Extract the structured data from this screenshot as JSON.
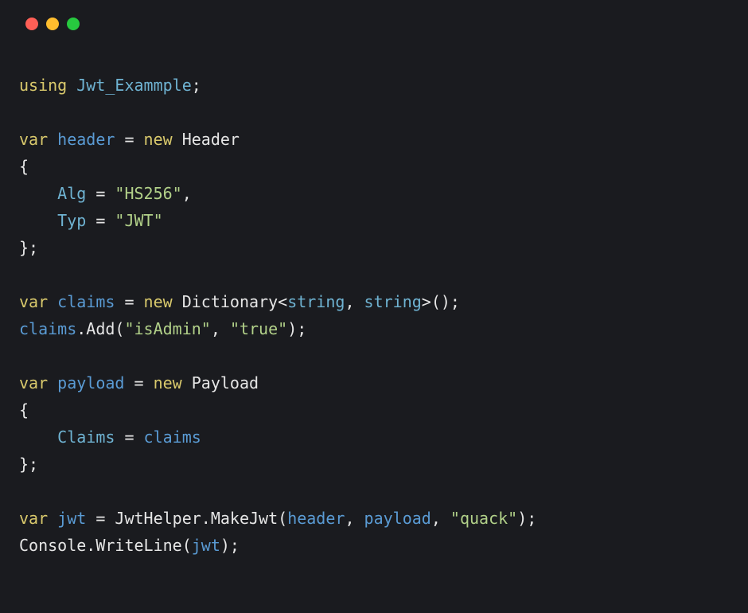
{
  "titlebar": {
    "dots": [
      "red",
      "yellow",
      "green"
    ]
  },
  "code": {
    "lines": [
      {
        "tokens": [
          {
            "t": "using",
            "c": "tok-keyword"
          },
          {
            "t": " ",
            "c": "tok-punct"
          },
          {
            "t": "Jwt_Exammple",
            "c": "tok-type"
          },
          {
            "t": ";",
            "c": "tok-punct"
          }
        ]
      },
      {
        "tokens": []
      },
      {
        "tokens": [
          {
            "t": "var",
            "c": "tok-keyword"
          },
          {
            "t": " ",
            "c": "tok-punct"
          },
          {
            "t": "header",
            "c": "tok-var"
          },
          {
            "t": " = ",
            "c": "tok-punct"
          },
          {
            "t": "new",
            "c": "tok-new"
          },
          {
            "t": " ",
            "c": "tok-punct"
          },
          {
            "t": "Header",
            "c": "tok-class"
          }
        ]
      },
      {
        "tokens": [
          {
            "t": "{",
            "c": "tok-punct"
          }
        ]
      },
      {
        "tokens": [
          {
            "t": "    ",
            "c": "tok-punct"
          },
          {
            "t": "Alg",
            "c": "tok-prop"
          },
          {
            "t": " = ",
            "c": "tok-punct"
          },
          {
            "t": "\"HS256\"",
            "c": "tok-string"
          },
          {
            "t": ",",
            "c": "tok-punct"
          }
        ]
      },
      {
        "tokens": [
          {
            "t": "    ",
            "c": "tok-punct"
          },
          {
            "t": "Typ",
            "c": "tok-prop"
          },
          {
            "t": " = ",
            "c": "tok-punct"
          },
          {
            "t": "\"JWT\"",
            "c": "tok-string"
          }
        ]
      },
      {
        "tokens": [
          {
            "t": "};",
            "c": "tok-punct"
          }
        ]
      },
      {
        "tokens": []
      },
      {
        "tokens": [
          {
            "t": "var",
            "c": "tok-keyword"
          },
          {
            "t": " ",
            "c": "tok-punct"
          },
          {
            "t": "claims",
            "c": "tok-var"
          },
          {
            "t": " = ",
            "c": "tok-punct"
          },
          {
            "t": "new",
            "c": "tok-new"
          },
          {
            "t": " ",
            "c": "tok-punct"
          },
          {
            "t": "Dictionary",
            "c": "tok-class"
          },
          {
            "t": "<",
            "c": "tok-punct"
          },
          {
            "t": "string",
            "c": "tok-generic"
          },
          {
            "t": ", ",
            "c": "tok-punct"
          },
          {
            "t": "string",
            "c": "tok-generic"
          },
          {
            "t": ">",
            "c": "tok-punct"
          },
          {
            "t": "();",
            "c": "tok-punct"
          }
        ]
      },
      {
        "tokens": [
          {
            "t": "claims",
            "c": "tok-var"
          },
          {
            "t": ".",
            "c": "tok-punct"
          },
          {
            "t": "Add",
            "c": "tok-method"
          },
          {
            "t": "(",
            "c": "tok-punct"
          },
          {
            "t": "\"isAdmin\"",
            "c": "tok-string"
          },
          {
            "t": ", ",
            "c": "tok-punct"
          },
          {
            "t": "\"true\"",
            "c": "tok-string"
          },
          {
            "t": ");",
            "c": "tok-punct"
          }
        ]
      },
      {
        "tokens": []
      },
      {
        "tokens": [
          {
            "t": "var",
            "c": "tok-keyword"
          },
          {
            "t": " ",
            "c": "tok-punct"
          },
          {
            "t": "payload",
            "c": "tok-var"
          },
          {
            "t": " = ",
            "c": "tok-punct"
          },
          {
            "t": "new",
            "c": "tok-new"
          },
          {
            "t": " ",
            "c": "tok-punct"
          },
          {
            "t": "Payload",
            "c": "tok-class"
          }
        ]
      },
      {
        "tokens": [
          {
            "t": "{",
            "c": "tok-punct"
          }
        ]
      },
      {
        "tokens": [
          {
            "t": "    ",
            "c": "tok-punct"
          },
          {
            "t": "Claims",
            "c": "tok-prop"
          },
          {
            "t": " = ",
            "c": "tok-punct"
          },
          {
            "t": "claims",
            "c": "tok-var"
          }
        ]
      },
      {
        "tokens": [
          {
            "t": "};",
            "c": "tok-punct"
          }
        ]
      },
      {
        "tokens": []
      },
      {
        "tokens": [
          {
            "t": "var",
            "c": "tok-keyword"
          },
          {
            "t": " ",
            "c": "tok-punct"
          },
          {
            "t": "jwt",
            "c": "tok-var"
          },
          {
            "t": " = ",
            "c": "tok-punct"
          },
          {
            "t": "JwtHelper",
            "c": "tok-class"
          },
          {
            "t": ".",
            "c": "tok-punct"
          },
          {
            "t": "MakeJwt",
            "c": "tok-method"
          },
          {
            "t": "(",
            "c": "tok-punct"
          },
          {
            "t": "header",
            "c": "tok-var"
          },
          {
            "t": ", ",
            "c": "tok-punct"
          },
          {
            "t": "payload",
            "c": "tok-var"
          },
          {
            "t": ", ",
            "c": "tok-punct"
          },
          {
            "t": "\"quack\"",
            "c": "tok-string"
          },
          {
            "t": ");",
            "c": "tok-punct"
          }
        ]
      },
      {
        "tokens": [
          {
            "t": "Console",
            "c": "tok-class"
          },
          {
            "t": ".",
            "c": "tok-punct"
          },
          {
            "t": "WriteLine",
            "c": "tok-method"
          },
          {
            "t": "(",
            "c": "tok-punct"
          },
          {
            "t": "jwt",
            "c": "tok-var"
          },
          {
            "t": ");",
            "c": "tok-punct"
          }
        ]
      }
    ]
  }
}
